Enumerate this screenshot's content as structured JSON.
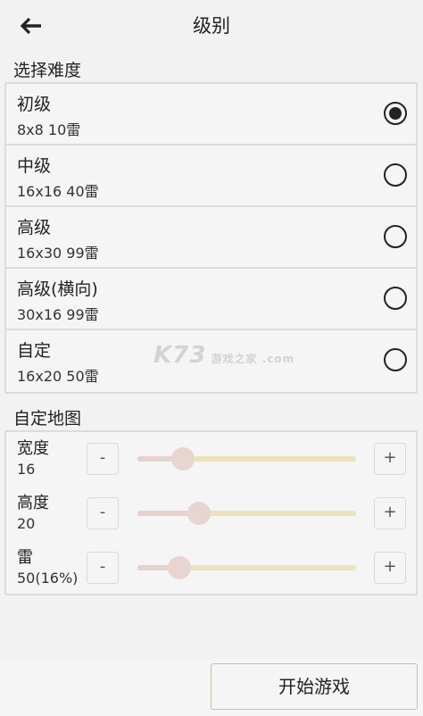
{
  "header": {
    "title": "级别",
    "back_icon": "arrow-left-icon"
  },
  "levels": {
    "section_label": "选择难度",
    "items": [
      {
        "name": "初级",
        "desc": "8x8  10雷",
        "selected": true
      },
      {
        "name": "中级",
        "desc": "16x16  40雷",
        "selected": false
      },
      {
        "name": "高级",
        "desc": "16x30  99雷",
        "selected": false
      },
      {
        "name": "高级(横向)",
        "desc": "30x16  99雷",
        "selected": false
      },
      {
        "name": "自定",
        "desc": "16x20  50雷",
        "selected": false
      }
    ]
  },
  "custom": {
    "section_label": "自定地图",
    "rows": [
      {
        "label": "宽度",
        "value": "16",
        "minus": "-",
        "plus": "+",
        "level": 0.21
      },
      {
        "label": "高度",
        "value": "20",
        "minus": "-",
        "plus": "+",
        "level": 0.28
      },
      {
        "label": "雷",
        "value": "50(16%)",
        "minus": "-",
        "plus": "+",
        "level": 0.19
      }
    ]
  },
  "footer": {
    "start_label": "开始游戏"
  },
  "watermark": {
    "text": "K73 游戏之家 .com"
  },
  "colors": {
    "slider_track": "#ede2bb",
    "slider_fill": "#e5d3cc",
    "slider_thumb": "#e8d4d0",
    "button_border": "#cdbf99"
  }
}
